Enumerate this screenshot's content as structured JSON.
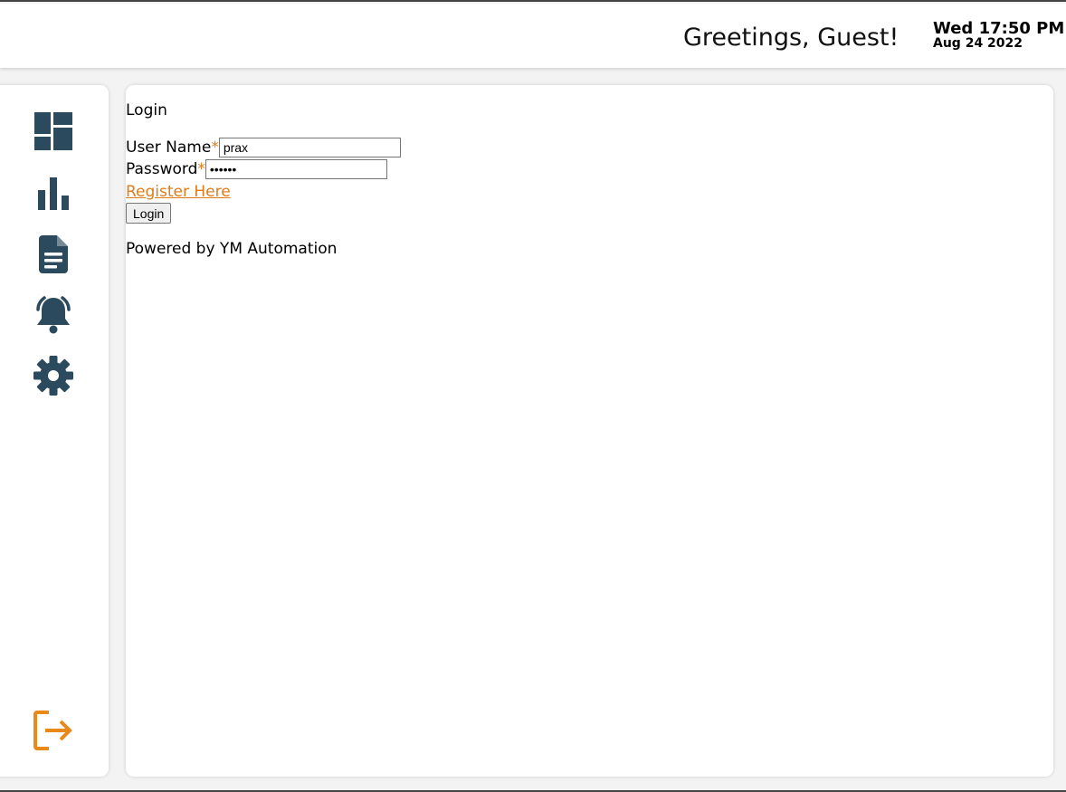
{
  "header": {
    "greeting": "Greetings, Guest!",
    "time": "Wed 17:50 PM",
    "date": "Aug 24 2022"
  },
  "sidebar": {
    "items": [
      {
        "icon": "dashboard-icon"
      },
      {
        "icon": "bar-chart-icon"
      },
      {
        "icon": "document-icon"
      },
      {
        "icon": "alarm-bell-icon"
      },
      {
        "icon": "gear-icon"
      }
    ],
    "logout_icon": "logout-icon",
    "icon_color": "#2c4a5e",
    "logout_color": "#e8891a"
  },
  "login": {
    "title": "Login",
    "username_label": "User Name",
    "username_value": "prax",
    "password_label": "Password",
    "password_value": "••••••",
    "required_marker": "*",
    "register_link": "Register Here",
    "login_button": "Login",
    "footer": "Powered by YM Automation",
    "accent_color": "#e07b1a"
  }
}
